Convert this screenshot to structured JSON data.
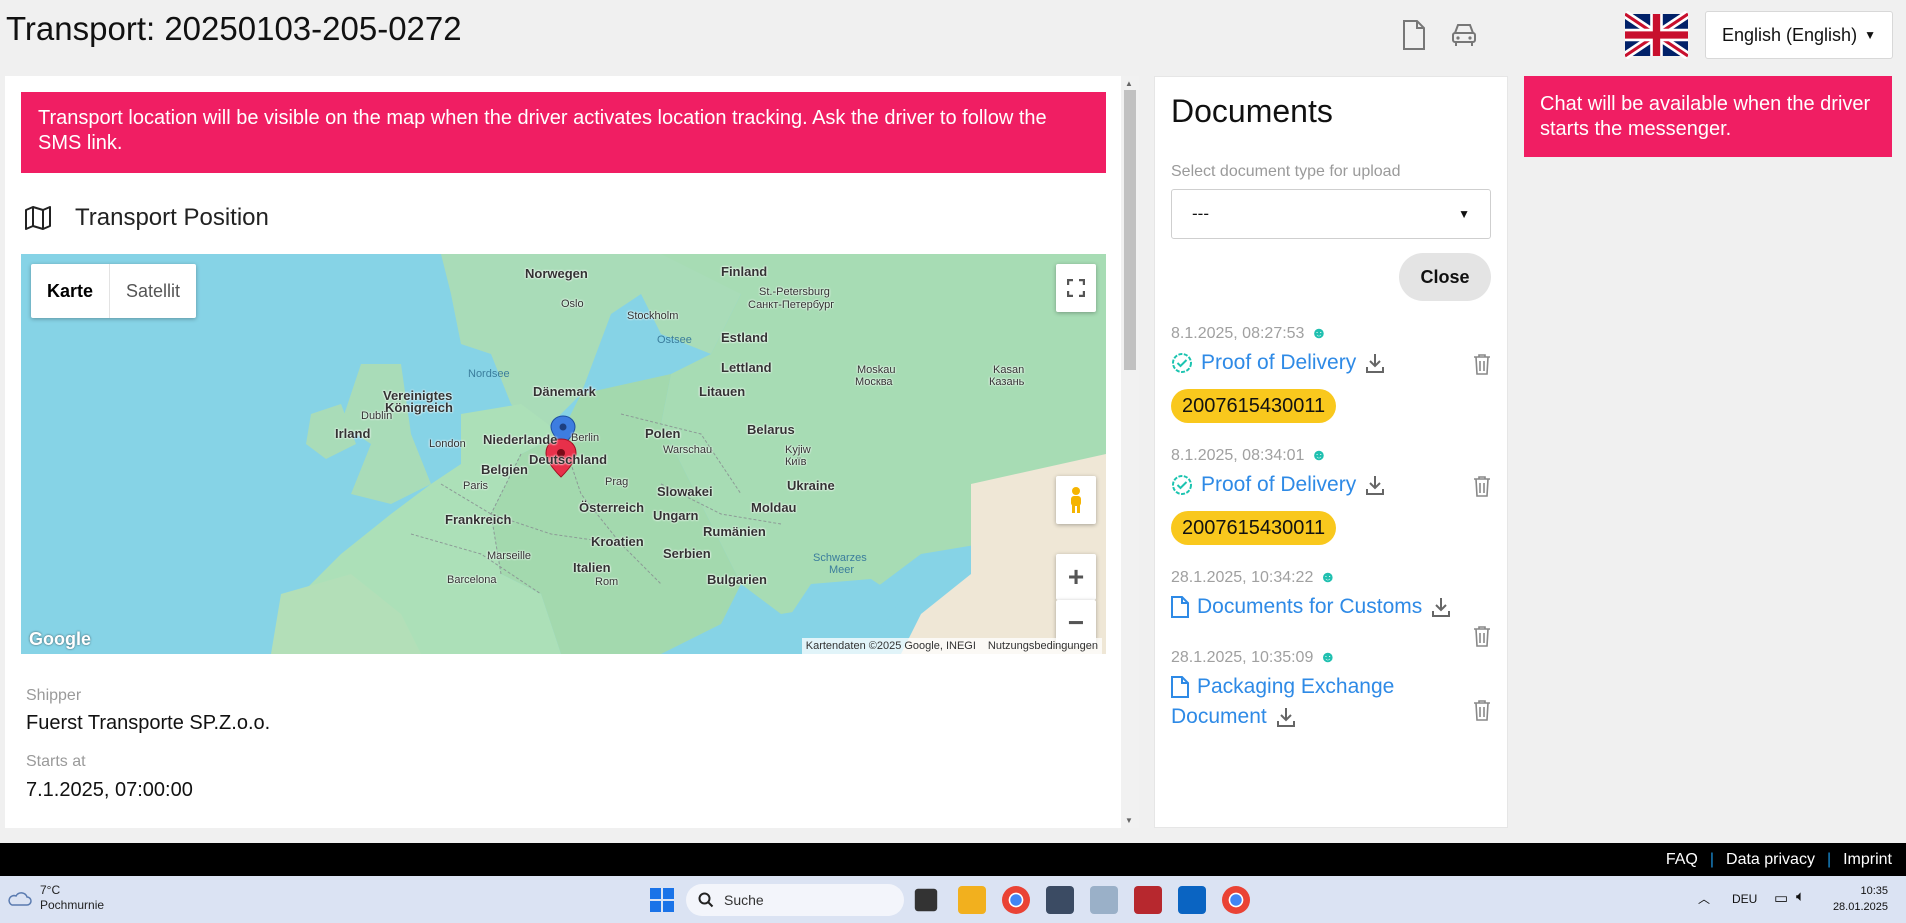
{
  "header": {
    "title": "Transport: 20250103-205-0272",
    "language": "English (English)"
  },
  "alerts": {
    "location": "Transport location will be visible on the map when the driver activates location tracking. Ask the driver to follow the SMS link.",
    "chat": "Chat will be available when the driver starts the messenger."
  },
  "position": {
    "title": "Transport Position",
    "map_type_map": "Karte",
    "map_type_satellite": "Satellit",
    "attribution": "Kartendaten ©2025 Google, INEGI",
    "terms": "Nutzungsbedingungen",
    "google": "Google",
    "labels": {
      "finland": "Finland",
      "norwegen": "Norwegen",
      "stpetersburg": "St.-Petersburg",
      "stpetersburg_ru": "Санкт-Петербург",
      "oslo": "Oslo",
      "stockholm": "Stockholm",
      "ostsee": "Ostsee",
      "estland": "Estland",
      "nordsee": "Nordsee",
      "lettland": "Lettland",
      "moskau": "Moskau",
      "moskva": "Москва",
      "kasan": "Kasan",
      "kazan": "Казань",
      "daenemark": "Dänemark",
      "litauen": "Litauen",
      "vereinigtes": "Vereinigtes",
      "koenigreich": "Königreich",
      "dublin": "Dublin",
      "irland": "Irland",
      "niederlande": "Niederlande",
      "berlin": "Berlin",
      "polen": "Polen",
      "belarus": "Belarus",
      "london": "London",
      "warschau": "Warschau",
      "deutschland": "Deutschland",
      "kyjiw": "Kyjiw",
      "kyiv": "Київ",
      "belgien": "Belgien",
      "prag": "Prag",
      "paris": "Paris",
      "slowakei": "Slowakei",
      "ukraine": "Ukraine",
      "oesterreich": "Österreich",
      "moldau": "Moldau",
      "frankreich": "Frankreich",
      "ungarn": "Ungarn",
      "rumaenien": "Rumänien",
      "kroatien": "Kroatien",
      "marseille": "Marseille",
      "serbien": "Serbien",
      "schwarzes": "Schwarzes",
      "meer": "Meer",
      "italien": "Italien",
      "barcelona": "Barcelona",
      "rom": "Rom",
      "bulgarien": "Bulgarien"
    }
  },
  "fields": {
    "shipper_label": "Shipper",
    "shipper_value": "Fuerst Transporte SP.Z.o.o.",
    "starts_label": "Starts at",
    "starts_value": "7.1.2025, 07:00:00"
  },
  "documents": {
    "title": "Documents",
    "select_label": "Select document type for upload",
    "select_value": "---",
    "close": "Close",
    "items": [
      {
        "date": "8.1.2025, 08:27:53",
        "name": "Proof of Delivery",
        "tag": "2007615430011"
      },
      {
        "date": "8.1.2025, 08:34:01",
        "name": "Proof of Delivery",
        "tag": "2007615430011"
      },
      {
        "date": "28.1.2025, 10:34:22",
        "name": "Documents for Customs"
      },
      {
        "date": "28.1.2025, 10:35:09",
        "name_line1": "Packaging Exchange",
        "name_line2": "Document"
      }
    ]
  },
  "footer": {
    "faq": "FAQ",
    "privacy": "Data privacy",
    "imprint": "Imprint",
    "separator": "|"
  },
  "taskbar": {
    "temp": "7°C",
    "location": "Pochmurnie",
    "search": "Suche",
    "lang": "DEU",
    "time": "10:35",
    "date": "28.01.2025"
  },
  "colors": {
    "alert": "#f01e63",
    "link": "#2e8ae6",
    "tag": "#f9c81d"
  }
}
